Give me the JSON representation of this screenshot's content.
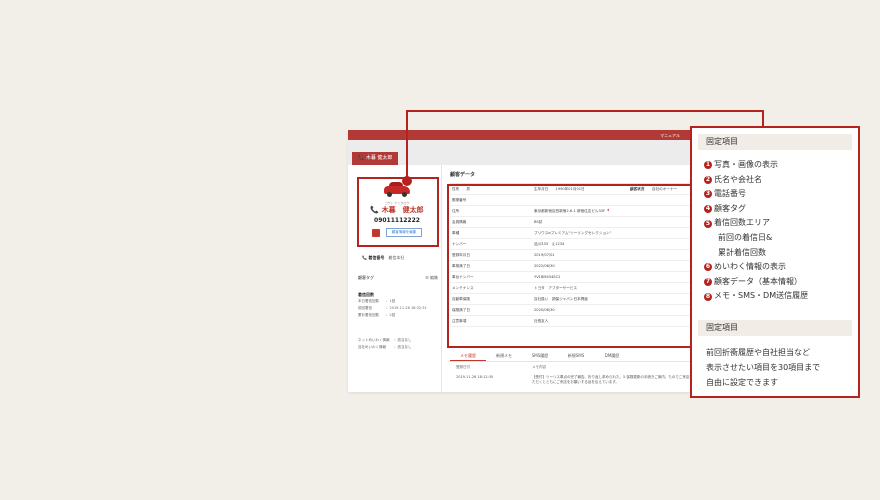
{
  "app": {
    "topbar_text": "マニュアル",
    "tab_label": "📞 木暮 健太郎"
  },
  "customer": {
    "kana": "コグレ ケンタロウ",
    "name": "📞 木暮　健太郎",
    "phone": "09011112222",
    "button_label": "顧客情報を編集"
  },
  "left": {
    "incoming_label": "📞 着信番号",
    "incoming_value": "着信本社",
    "tag_label": "顧客タグ",
    "tag_edit": "☰ 編集",
    "count_title": "着信回数",
    "counts": [
      {
        "k": "本日着信回数",
        "v": "：1回"
      },
      {
        "k": "前回着信",
        "v": "：2019-11-26 18:32:31"
      },
      {
        "k": "累計着信回数",
        "v": "：2回"
      }
    ],
    "waku": [
      {
        "k": "ネットめいわく情報",
        "v": "：該当なし"
      },
      {
        "k": "自社めいわく情報",
        "v": "：該当なし"
      }
    ]
  },
  "main": {
    "section_title": "顧客データ",
    "rows": [
      {
        "k": "性別　　男",
        "v": "生年月日　　1990年01月01日",
        "k2": "顧客状況",
        "v2": "自社のオーナー"
      },
      {
        "k": "郵便番号",
        "v": ""
      },
      {
        "k": "住所",
        "v": "東京都新宿区西新宿2-6-1 新宿住友ビル33F 📍"
      },
      {
        "k": "会員情報",
        "v": "BS試"
      },
      {
        "k": "車種",
        "v": "プリウスαプレミアム\"ツーリングセレクション\""
      },
      {
        "k": "ナンバー",
        "v": "品川333　え1234"
      },
      {
        "k": "登録年月日",
        "v": "2019/07/01"
      },
      {
        "k": "車検満了日",
        "v": "2022/06/30"
      },
      {
        "k": "車台ナンバー",
        "v": "YV1BM434EC2"
      },
      {
        "k": "メンテナンス",
        "v": "トヨタ　アフターサービス"
      },
      {
        "k": "自動車保険",
        "v": "自社扱い　損保ジャパン日本興亜"
      },
      {
        "k": "保険満了日",
        "v": "2020/06/30"
      },
      {
        "k": "注意事項",
        "v": "社長友人"
      }
    ],
    "tabs": [
      "メモ履歴",
      "新規メモ",
      "SMS履歴",
      "新規SMS",
      "DM履歴"
    ],
    "memo_head": [
      "登録日付",
      "メモ内容"
    ],
    "memo_row": [
      "2019-11-26 18:12:30",
      "【受付】ツーリス車点の完了報告。折り返し求められた。5.保険更新の手続きご案内。たのでご来店いただくとともにご来店をお願いする旨を伝えています。"
    ]
  },
  "info": {
    "head1": "固定項目",
    "items": [
      {
        "num": "1",
        "text": "写真・画像の表示"
      },
      {
        "num": "2",
        "text": "氏名や会社名"
      },
      {
        "num": "3",
        "text": "電話番号"
      },
      {
        "num": "4",
        "text": "顧客タグ"
      },
      {
        "num": "5",
        "text": "着信回数エリア"
      }
    ],
    "sub5a": "前回の着信日&",
    "sub5b": "累計着信回数",
    "items2": [
      {
        "num": "6",
        "text": "めいわく情報の表示"
      },
      {
        "num": "7",
        "text": "顧客データ（基本情報）"
      },
      {
        "num": "8",
        "text": "メモ・SMS・DM送信履歴"
      }
    ],
    "head2": "固定項目",
    "para": [
      "前回折衝履歴や自社担当など",
      "表示させたい項目を30項目まで",
      "自由に設定できます"
    ]
  },
  "colors": {
    "accent": "#b5231f",
    "panel_head": "#f1ece6"
  }
}
